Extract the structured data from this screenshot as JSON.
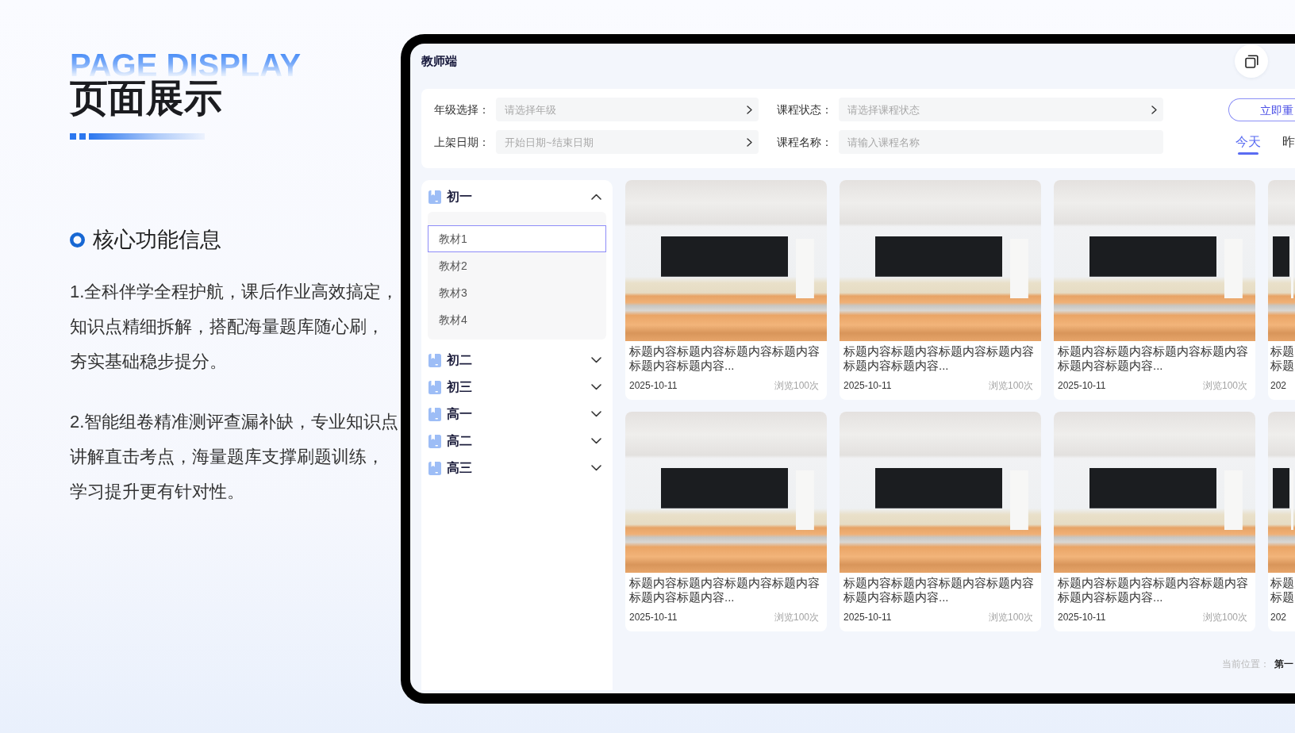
{
  "intro": {
    "eyebrow": "PAGE DISPLAY",
    "title": "页面展示"
  },
  "feature": {
    "heading": "核心功能信息",
    "paragraphs": [
      "1.全科伴学全程护航，课后作业高效搞定，知识点精细拆解，搭配海量题库随心刷，夯实基础稳步提分。",
      "2.智能组卷精准测评查漏补缺，专业知识点讲解直击考点，海量题库支撑刷题训练，学习提升更有针对性。"
    ]
  },
  "app": {
    "title": "教师端",
    "filters": [
      {
        "kind": "select",
        "label": "年级选择：",
        "placeholder": "请选择年级"
      },
      {
        "kind": "select",
        "label": "课程状态：",
        "placeholder": "请选择课程状态"
      },
      {
        "kind": "select",
        "label": "上架日期：",
        "placeholder": "开始日期~结束日期"
      },
      {
        "kind": "text",
        "label": "课程名称：",
        "placeholder": "请输入课程名称"
      }
    ],
    "reset_button": "立即重",
    "date_tabs": [
      {
        "label": "今天",
        "selected": true
      },
      {
        "label": "昨",
        "selected": false
      }
    ],
    "grades": [
      {
        "label": "初一",
        "expanded": true,
        "children": [
          {
            "label": "教材1",
            "selected": true
          },
          {
            "label": "教材2",
            "selected": false
          },
          {
            "label": "教材3",
            "selected": false
          },
          {
            "label": "教材4",
            "selected": false
          }
        ]
      },
      {
        "label": "初二",
        "expanded": false
      },
      {
        "label": "初三",
        "expanded": false
      },
      {
        "label": "高一",
        "expanded": false
      },
      {
        "label": "高二",
        "expanded": false
      },
      {
        "label": "高三",
        "expanded": false
      }
    ],
    "cards": [
      {
        "kind": "full",
        "title": "标题内容标题内容标题内容标题内容标题内容标题内容...",
        "date": "2025-10-11",
        "views": "浏览100次"
      },
      {
        "kind": "full",
        "title": "标题内容标题内容标题内容标题内容标题内容标题内容...",
        "date": "2025-10-11",
        "views": "浏览100次"
      },
      {
        "kind": "full",
        "title": "标题内容标题内容标题内容标题内容标题内容标题内容...",
        "date": "2025-10-11",
        "views": "浏览100次"
      },
      {
        "kind": "cut",
        "title": "标题标题",
        "date": "202"
      },
      {
        "kind": "full",
        "title": "标题内容标题内容标题内容标题内容标题内容标题内容...",
        "date": "2025-10-11",
        "views": "浏览100次"
      },
      {
        "kind": "full",
        "title": "标题内容标题内容标题内容标题内容标题内容标题内容...",
        "date": "2025-10-11",
        "views": "浏览100次"
      },
      {
        "kind": "full",
        "title": "标题内容标题内容标题内容标题内容标题内容标题内容...",
        "date": "2025-10-11",
        "views": "浏览100次"
      },
      {
        "kind": "cut",
        "title": "标题标题",
        "date": "202"
      }
    ],
    "location": {
      "label": "当前位置：",
      "value": "第一"
    }
  }
}
